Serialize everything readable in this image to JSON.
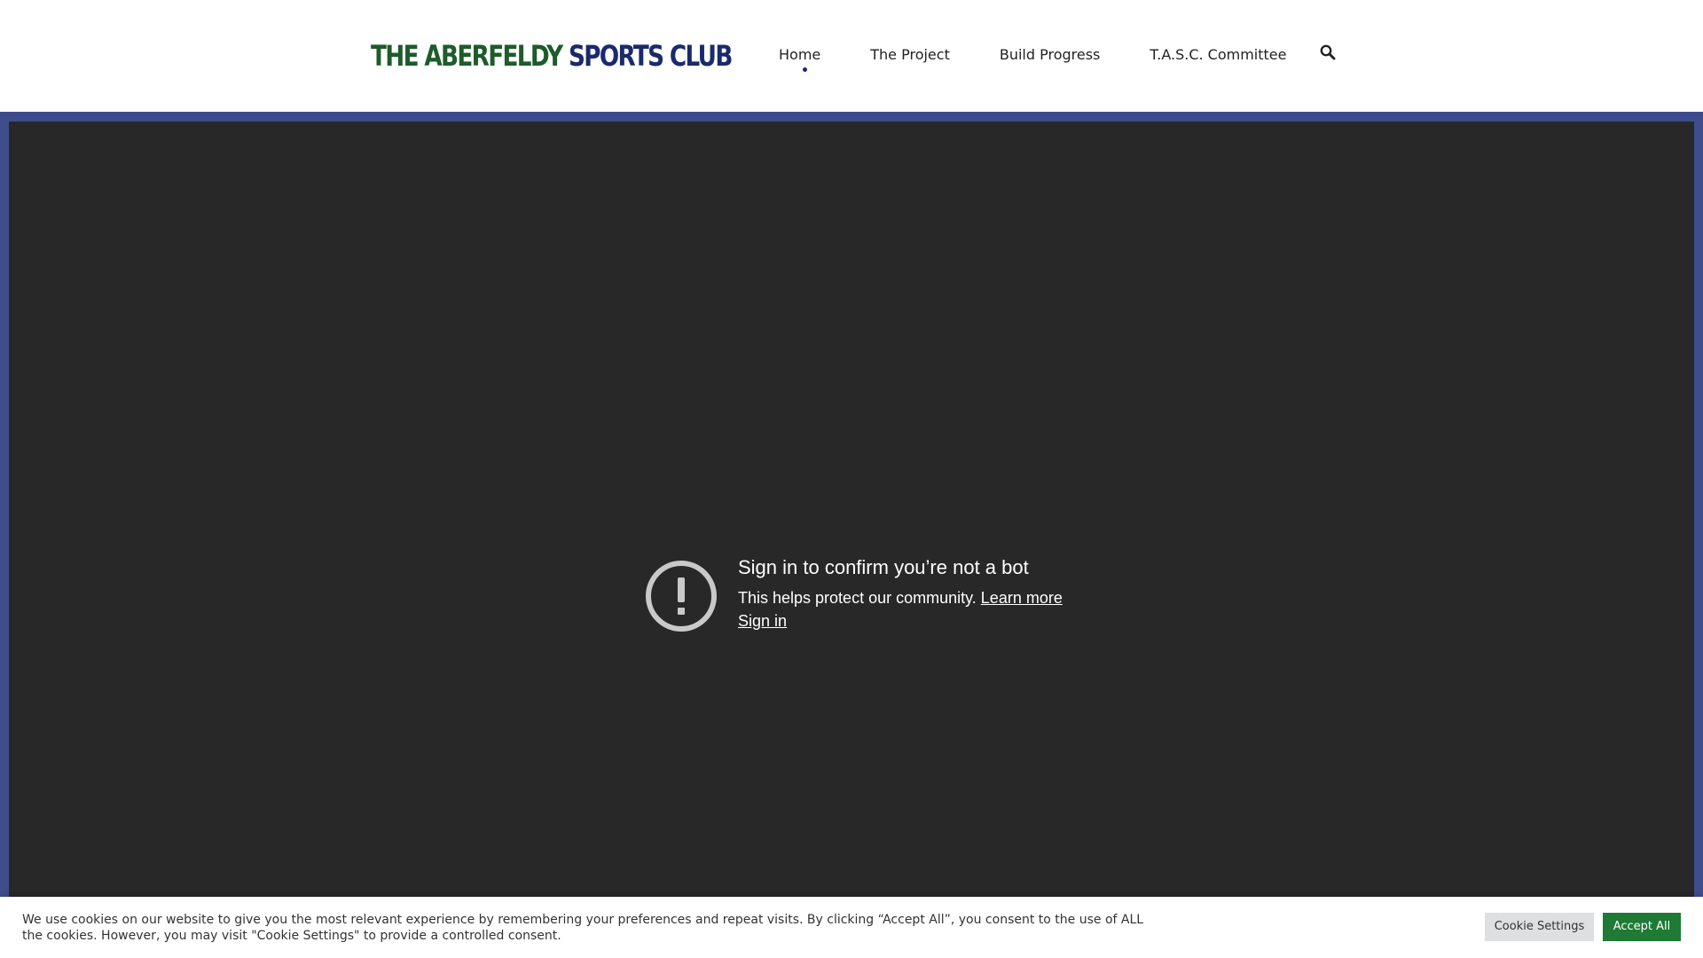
{
  "header": {
    "logo_part1": "THE ABERFELDY",
    "logo_part2": "SPORTS CLUB",
    "nav": [
      {
        "label": "Home",
        "active": true
      },
      {
        "label": "The Project"
      },
      {
        "label": "Build Progress"
      },
      {
        "label": "T.A.S.C. Committee"
      }
    ],
    "search_icon": "search-icon"
  },
  "video": {
    "alert_icon": "exclamation-circle-icon",
    "title": "Sign in to confirm you’re not a bot",
    "body": "This helps protect our community.",
    "learn_more": "Learn more",
    "sign_in": "Sign in"
  },
  "cookie": {
    "line1": "We use cookies on our website to give you the most relevant experience by remembering your preferences and repeat visits. By clicking “Accept All”, you consent to the use of ALL",
    "line2": "the cookies. However, you may visit \"Cookie Settings\" to provide a controlled consent.",
    "settings_label": "Cookie Settings",
    "accept_label": "Accept All"
  },
  "colors": {
    "brand_green": "#1e5b2b",
    "brand_navy": "#1a2a6c",
    "banner_blue": "#3f4d8c",
    "player_bg": "#282828",
    "accept_green": "#1e7a34"
  }
}
